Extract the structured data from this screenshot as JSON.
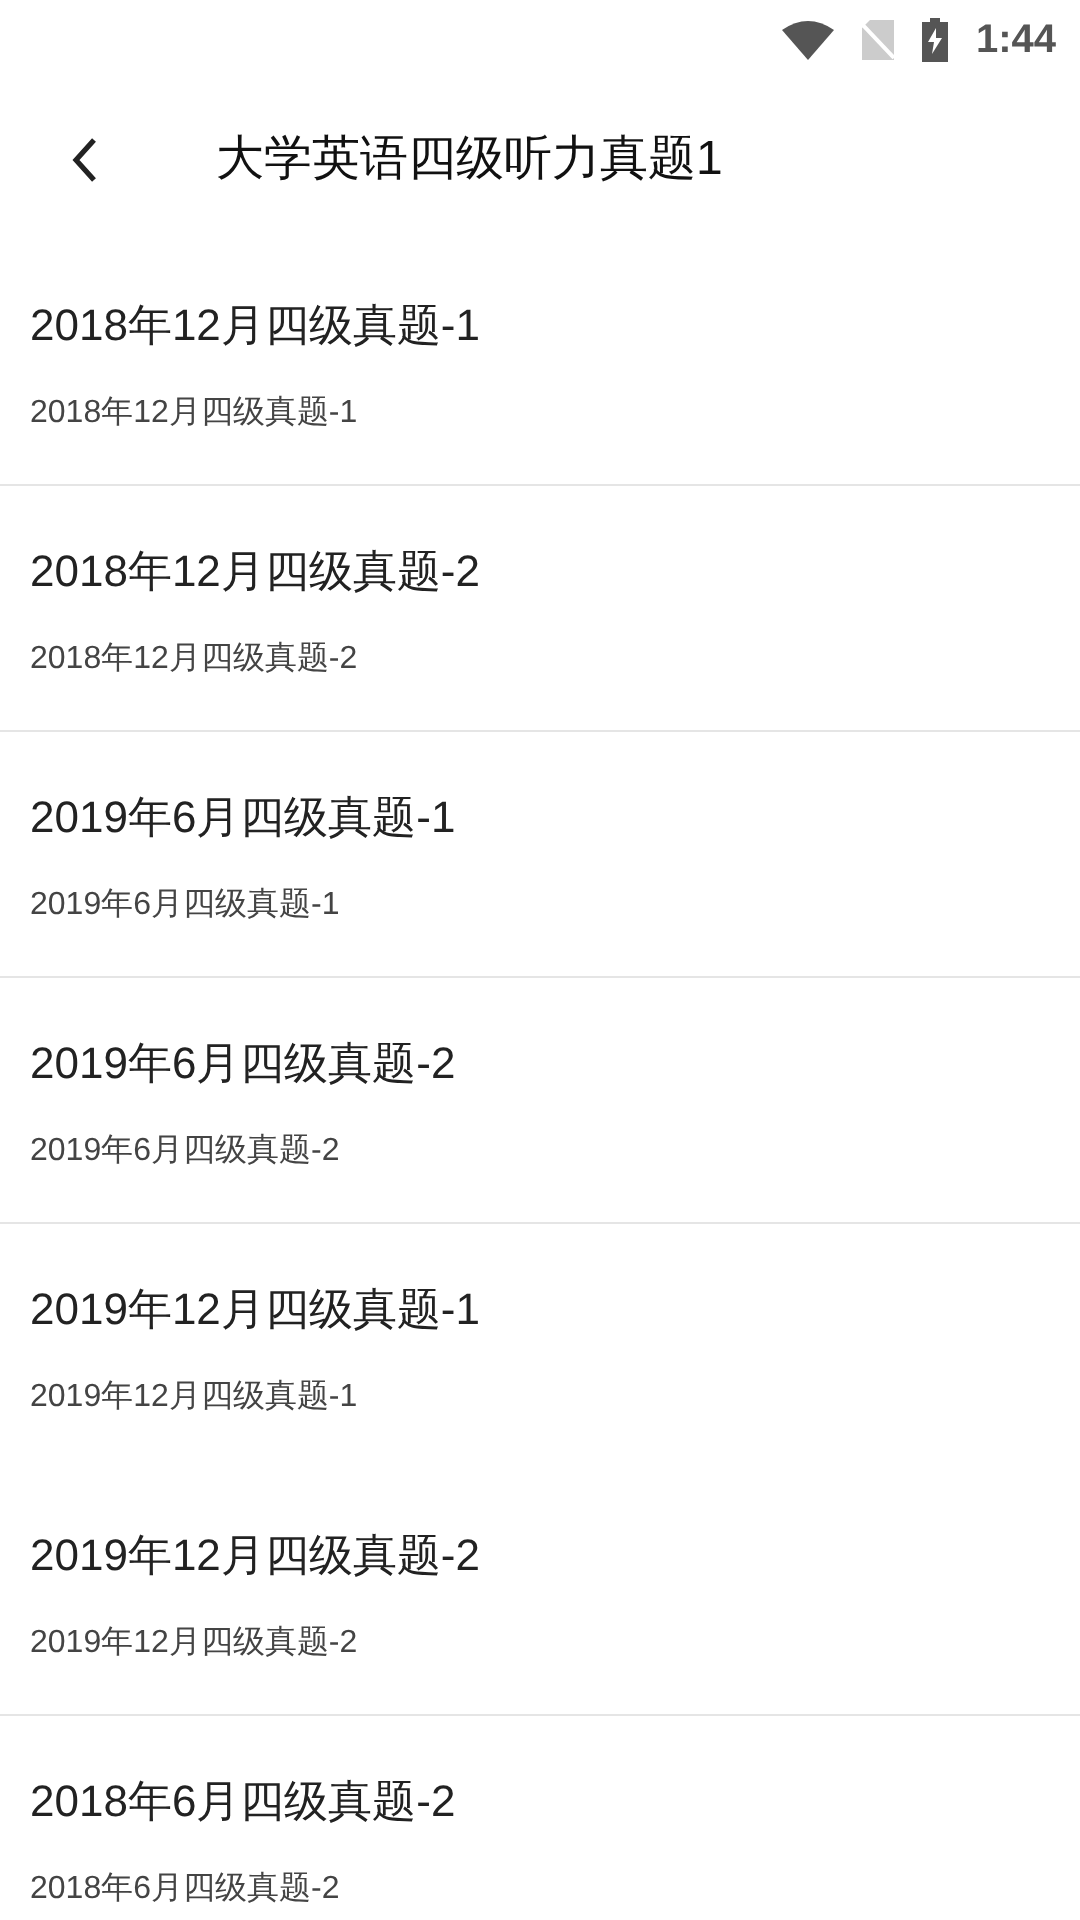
{
  "status_bar": {
    "time": "1:44"
  },
  "header": {
    "title": "大学英语四级听力真题1"
  },
  "items": [
    {
      "title": "2018年12月四级真题-1",
      "subtitle": "2018年12月四级真题-1",
      "divider": true
    },
    {
      "title": "2018年12月四级真题-2",
      "subtitle": "2018年12月四级真题-2",
      "divider": true
    },
    {
      "title": "2019年6月四级真题-1",
      "subtitle": "2019年6月四级真题-1",
      "divider": true
    },
    {
      "title": "2019年6月四级真题-2",
      "subtitle": "2019年6月四级真题-2",
      "divider": true
    },
    {
      "title": "2019年12月四级真题-1",
      "subtitle": "2019年12月四级真题-1",
      "divider": false
    },
    {
      "title": "2019年12月四级真题-2",
      "subtitle": "2019年12月四级真题-2",
      "divider": true
    },
    {
      "title": "2018年6月四级真题-2",
      "subtitle": "2018年6月四级真题-2",
      "divider": false
    }
  ]
}
